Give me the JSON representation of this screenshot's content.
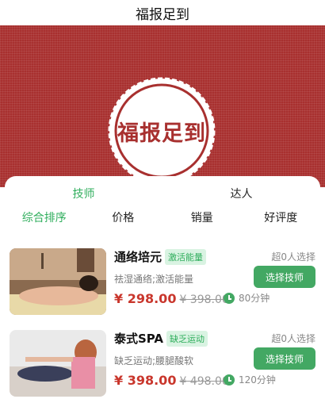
{
  "nav": {
    "title": "福报足到"
  },
  "banner": {
    "seal_text": "福报足到"
  },
  "tabs": [
    {
      "label": "技师",
      "active": true
    },
    {
      "label": "达人",
      "active": false
    }
  ],
  "sorts": [
    {
      "label": "综合排序",
      "active": true
    },
    {
      "label": "价格",
      "active": false
    },
    {
      "label": "销量",
      "active": false
    },
    {
      "label": "好评度",
      "active": false
    }
  ],
  "services": [
    {
      "title": "通络培元",
      "tag": "激活能量",
      "count": "超0人选择",
      "desc": "祛湿通络;激活能量",
      "button": "选择技师",
      "price": "¥ 298.00",
      "old_price": "¥ 398.00",
      "duration": "80分钟"
    },
    {
      "title": "泰式SPA",
      "tag": "缺乏运动",
      "count": "超0人选择",
      "desc": "缺乏运动;腰腿酸软",
      "button": "选择技师",
      "price": "¥ 398.00",
      "old_price": "¥ 498.00",
      "duration": "120分钟"
    }
  ],
  "colors": {
    "brand_red": "#a8302f",
    "accent_green": "#2fae5c",
    "price_red": "#c9362c"
  }
}
